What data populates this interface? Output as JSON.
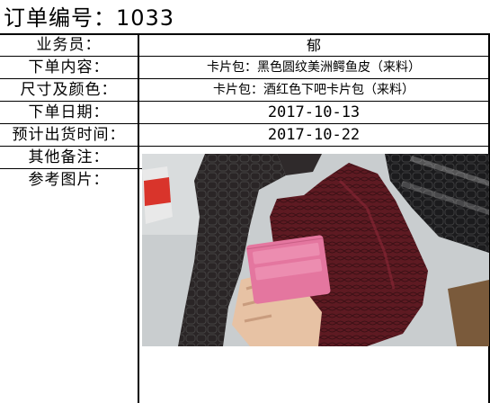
{
  "order": {
    "title": "订单编号：1033"
  },
  "fields": {
    "salesperson": {
      "label": "业务员：",
      "value": "郁"
    },
    "content": {
      "label": "下单内容：",
      "value": "卡片包：黑色圆纹美洲鳄鱼皮（来料）"
    },
    "size_color": {
      "label": "尺寸及颜色：",
      "value": "卡片包：酒红色下吧卡片包（来料）"
    },
    "order_date": {
      "label": "下单日期：",
      "value": "2017-10-13"
    },
    "ship_date": {
      "label": "预计出货时间：",
      "value": "2017-10-22"
    },
    "notes": {
      "label": "其他备注：",
      "value": ""
    },
    "reference": {
      "label": "参考图片："
    }
  },
  "colors": {
    "black_leather": "#2a2526",
    "burgundy_leather": "#5e1a22",
    "pink_card": "#e4769f",
    "table_surface": "#cfd2d3"
  }
}
